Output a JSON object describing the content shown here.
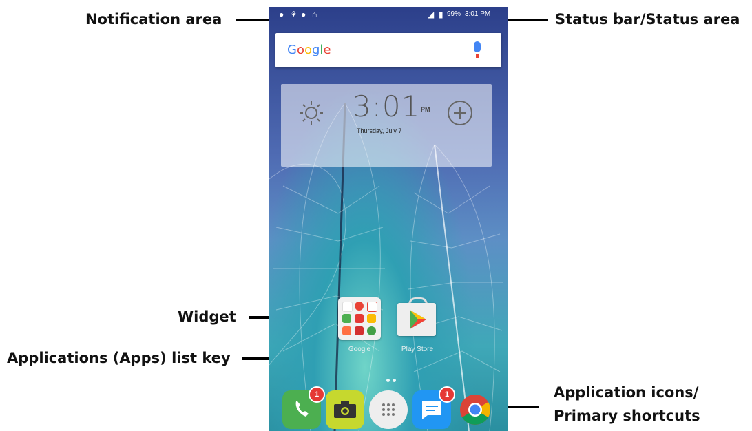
{
  "labels": {
    "notification_area": "Notification area",
    "status_bar": "Status bar/Status area",
    "widget": "Widget",
    "apps_list_key": "Applications (Apps) list key",
    "app_icons_line1": "Application icons/",
    "app_icons_line2": "Primary shortcuts"
  },
  "status_bar": {
    "battery": "99%",
    "time": "3:01 PM"
  },
  "search": {
    "logo": "Google"
  },
  "clock_widget": {
    "time": "3:01",
    "ampm": "PM",
    "date": "Thursday, July 7"
  },
  "home": {
    "folder_label": "Google",
    "playstore_label": "Play Store"
  },
  "dock": {
    "phone_badge": "1",
    "messages_badge": "1"
  }
}
